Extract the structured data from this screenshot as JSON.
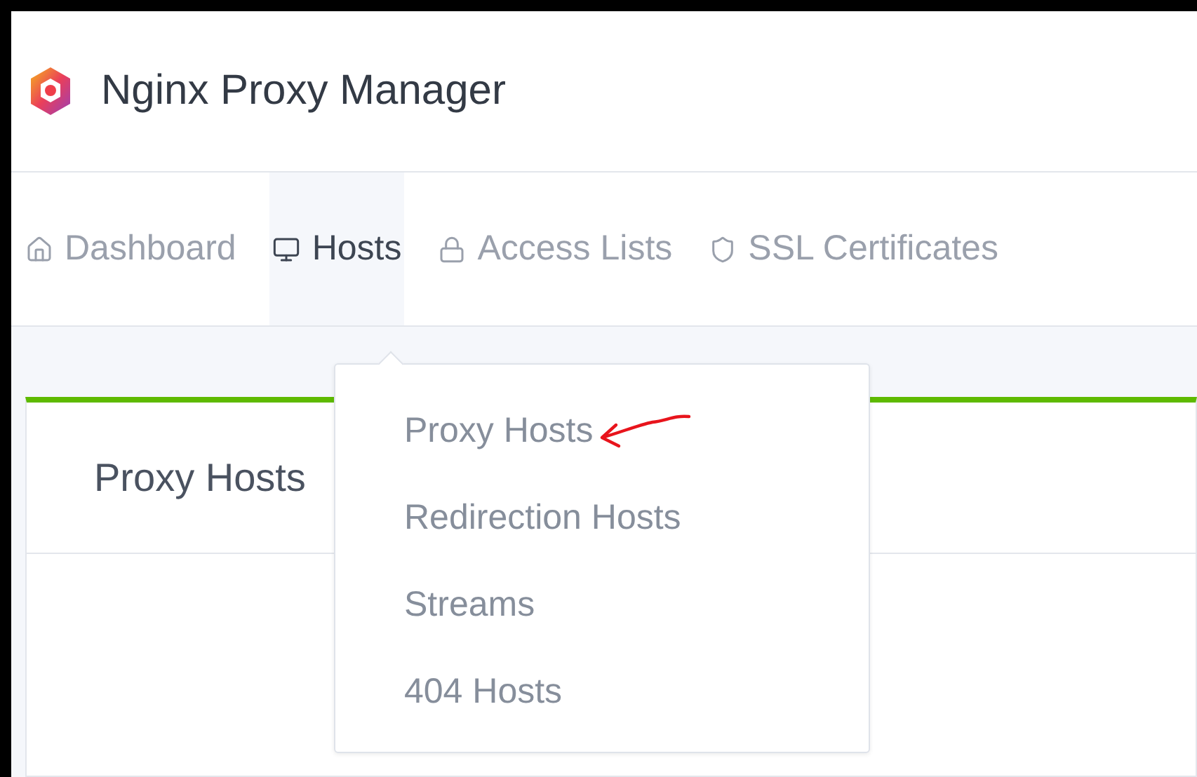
{
  "app": {
    "title": "Nginx Proxy Manager"
  },
  "nav": [
    {
      "label": "Dashboard",
      "selected": false
    },
    {
      "label": "Hosts",
      "selected": true
    },
    {
      "label": "Access Lists",
      "selected": false
    },
    {
      "label": "SSL Certificates",
      "selected": false
    }
  ],
  "dropdown": {
    "items": [
      {
        "label": "Proxy Hosts",
        "annotated": true
      },
      {
        "label": "Redirection Hosts",
        "annotated": false
      },
      {
        "label": "Streams",
        "annotated": false
      },
      {
        "label": "404 Hosts",
        "annotated": false
      }
    ]
  },
  "card": {
    "title": "Proxy Hosts"
  }
}
